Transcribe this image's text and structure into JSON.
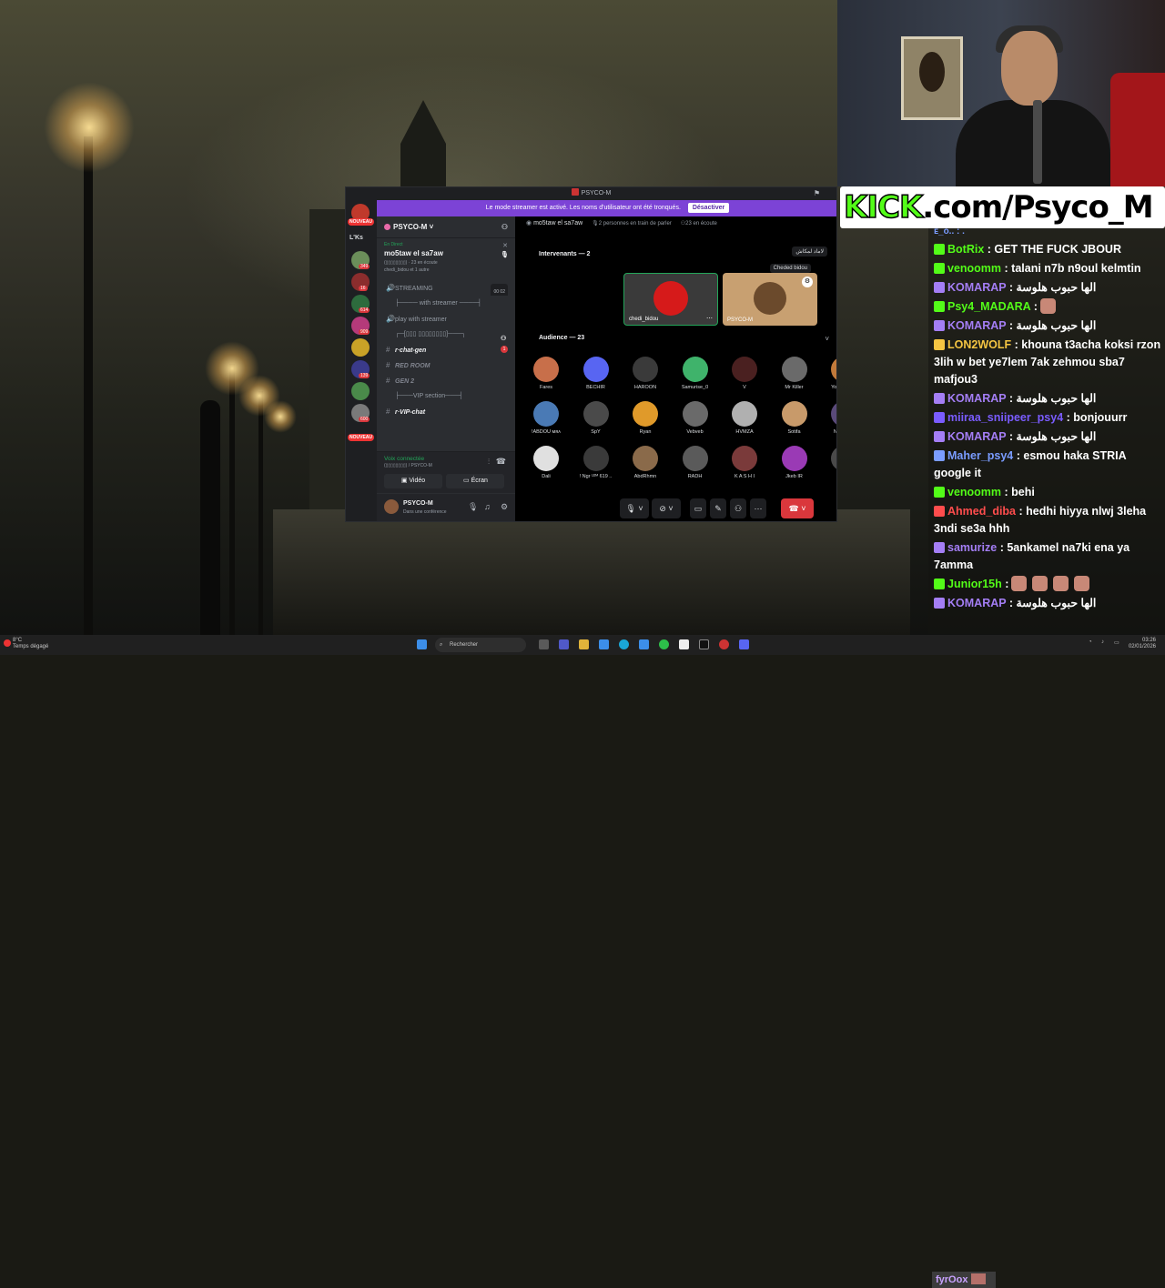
{
  "stream": {
    "kick_prefix": "KICK",
    "kick_suffix": ".com/Psyco_M"
  },
  "chat": {
    "top_partial": "ᴇ_ᴏ.. : .",
    "messages": [
      {
        "user": "BotRix",
        "color": "#53fc18",
        "text": ": GET THE FUCK JBOUR",
        "emotes": 0
      },
      {
        "user": "venoomm",
        "color": "#53fc18",
        "text": ": talani n7b n9oul kelmtin",
        "emotes": 0
      },
      {
        "user": "KOMARAP",
        "color": "#a47ef5",
        "text": ": الها حبوب هلوسة",
        "emotes": 0
      },
      {
        "user": "Psy4_MADARA",
        "color": "#53fc18",
        "text": ":",
        "emotes": 1
      },
      {
        "user": "KOMARAP",
        "color": "#a47ef5",
        "text": ": الها حبوب هلوسة",
        "emotes": 0
      },
      {
        "user": "LON2WOLF",
        "color": "#f5c542",
        "text": ": khouna t3acha koksi rzon 3lih w bet ye7lem 7ak zehmou sba7 mafjou3",
        "emotes": 0
      },
      {
        "user": "KOMARAP",
        "color": "#a47ef5",
        "text": ": الها حبوب هلوسة",
        "emotes": 0
      },
      {
        "user": "miiraa_sniipeer_psy4",
        "color": "#7a5cff",
        "text": ": bonjouurr",
        "emotes": 0
      },
      {
        "user": "KOMARAP",
        "color": "#a47ef5",
        "text": ": الها حبوب هلوسة",
        "emotes": 0
      },
      {
        "user": "Maher_psy4",
        "color": "#7a9cff",
        "text": ": esmou haka STRIA google it",
        "emotes": 0
      },
      {
        "user": "venoomm",
        "color": "#53fc18",
        "text": ": behi",
        "emotes": 0
      },
      {
        "user": "Ahmed_diba",
        "color": "#ff4d4d",
        "text": ": hedhi hiyya nlwj 3leha 3ndi se3a hhh",
        "emotes": 0
      },
      {
        "user": "samurize",
        "color": "#a47ef5",
        "text": ": 5ankamel na7ki ena ya 7amma",
        "emotes": 0
      },
      {
        "user": "Junior15h",
        "color": "#53fc18",
        "text": ":",
        "emotes": 4
      },
      {
        "user": "KOMARAP",
        "color": "#a47ef5",
        "text": ": الها حبوب هلوسة",
        "emotes": 0
      }
    ]
  },
  "discord": {
    "window_title": "PSYCO-M",
    "streamer_banner": "Le mode streamer est activé. Les noms d'utilisateur ont été tronqués.",
    "streamer_button": "Désactiver",
    "guilds": {
      "new1": "NOUVEAU",
      "lks": "L'Ks",
      "new2": "NOUVEAU",
      "counts": [
        "349",
        "16",
        "614",
        "909",
        "139",
        "600"
      ]
    },
    "server_name": "PSYCO-M",
    "live": {
      "label": "En Direct",
      "title": "mo5taw el sa7aw",
      "listeners": "(▯▯▯▯▯▯▯▯) · 23 en écoute",
      "speakers": "chedi_bidou et 1 autre"
    },
    "channels": [
      {
        "icon": "🔊",
        "label": "STREAMING",
        "extra": "00 02"
      },
      {
        "icon": "",
        "label": "├──── with streamer ────┤",
        "extra": ""
      },
      {
        "icon": "🔊",
        "label": "play with streamer",
        "extra": ""
      },
      {
        "icon": "",
        "label": "┌─[▯▯▯ ▯▯▯▯▯▯▯▯]───┐",
        "extra": ""
      },
      {
        "icon": "#",
        "label": "r·chat-gen",
        "extra": "1"
      },
      {
        "icon": "#",
        "label": "RED ROOM",
        "extra": ""
      },
      {
        "icon": "#",
        "label": "GEN 2",
        "extra": ""
      },
      {
        "icon": "",
        "label": "├───VIP section───┤",
        "extra": ""
      },
      {
        "icon": "#",
        "label": "r·VIP-chat",
        "extra": ""
      }
    ],
    "voice": {
      "connected": "Voix connectée",
      "server": "(▯▯▯▯▯▯▯▯) / PSYCO-M",
      "video_label": "Vidéo",
      "screen_label": "Écran"
    },
    "user": {
      "name": "PSYCO-M",
      "status": "Dans une conférence"
    },
    "stage": {
      "channel": "mo5taw el sa7aw",
      "speaking": "2 personnes en train de parler",
      "listening": "23 en écoute",
      "speakers_header": "Intervenants — 2",
      "audience_header": "Audience — 23",
      "speakers": [
        {
          "name": "chedi_bidou",
          "color": "#d61a1a"
        },
        {
          "name": "PSYCO-M",
          "color": "#c8a071"
        }
      ],
      "float1": "لاماد لمكاش",
      "float2": "Cheded bidou",
      "audience": [
        {
          "name": "Fares",
          "color": "#c86f4a"
        },
        {
          "name": "BECHIR",
          "color": "#5865f2"
        },
        {
          "name": "HAROON",
          "color": "#3a3a3a"
        },
        {
          "name": "Samurise_0",
          "color": "#3fb36b"
        },
        {
          "name": "V",
          "color": "#4a2020"
        },
        {
          "name": "Mr Killer",
          "color": "#6a6a6a"
        },
        {
          "name": "Youssef ✨",
          "color": "#c27a3a"
        },
        {
          "name": "TheCracker",
          "color": "#c8c29a"
        },
        {
          "name": "!ABDOU ᴍʀᴀ",
          "color": "#4a7ab5"
        },
        {
          "name": "SpY",
          "color": "#4a4a4a"
        },
        {
          "name": "Ryan",
          "color": "#e09a2a"
        },
        {
          "name": "Vebveb",
          "color": "#6a6a6a"
        },
        {
          "name": "HVMZA",
          "color": "#b0b0b0"
        },
        {
          "name": "Sotifa",
          "color": "#c89a6a"
        },
        {
          "name": "Nadhir02",
          "color": "#5a4a7a"
        },
        {
          "name": "Arbi",
          "color": "#2a2a2a"
        },
        {
          "name": "Dali",
          "color": "#e0e0e0"
        },
        {
          "name": "! Ngr ᴸᴱᴹ 619 ..",
          "color": "#3a3a3a"
        },
        {
          "name": "AbdRhmn",
          "color": "#8a6a4a"
        },
        {
          "name": "RADH",
          "color": "#5a5a5a"
        },
        {
          "name": "K A S H I",
          "color": "#7a3a3a"
        },
        {
          "name": "Jkeb IR",
          "color": "#9a3ab5"
        },
        {
          "name": "SMB",
          "color": "#4a4a4a"
        }
      ]
    }
  },
  "taskbar": {
    "temp": "8°C",
    "weather": "Temps dégagé",
    "search": "Rechercher",
    "time": "03:26",
    "date": "02/01/2026",
    "overlay_name": "fyrOox"
  }
}
